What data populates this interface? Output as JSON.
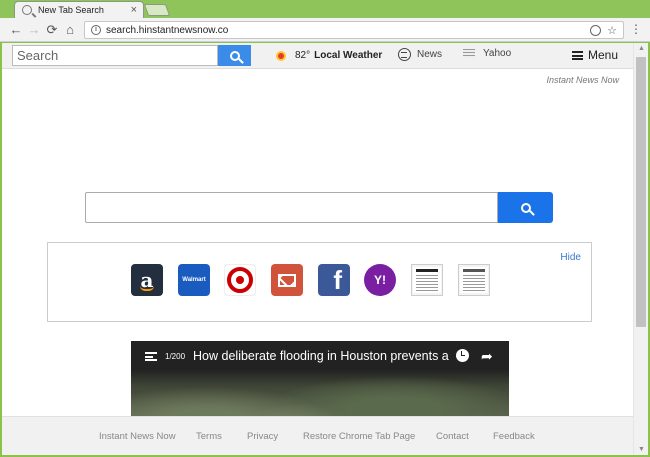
{
  "browser": {
    "tab_title": "New Tab Search",
    "tab_close": "×",
    "back": "←",
    "forward": "→",
    "reload": "⟳",
    "home": "⌂",
    "url": "search.hinstantnewsnow.co",
    "info": "i",
    "bookmark_star": "☆",
    "menu_dots": "⋮"
  },
  "topbar": {
    "search_placeholder": "Search",
    "temperature": "82°",
    "weather_label": "Local Weather",
    "news_label": "News",
    "yahoo_label": "Yahoo",
    "menu_label": "Menu"
  },
  "brand": "Instant News Now",
  "tiles": {
    "hide_label": "Hide",
    "items": [
      {
        "name": "Amazon",
        "glyph": "a"
      },
      {
        "name": "Walmart",
        "glyph": "Walmart"
      },
      {
        "name": "Target",
        "glyph": ""
      },
      {
        "name": "Gmail",
        "glyph": ""
      },
      {
        "name": "Facebook",
        "glyph": "f"
      },
      {
        "name": "Yahoo",
        "glyph": "Y!"
      }
    ]
  },
  "video": {
    "counter": "1/200",
    "title": "How deliberate flooding in Houston prevents a ..."
  },
  "footer": {
    "links": [
      "Instant News Now",
      "Terms",
      "Privacy",
      "Restore Chrome Tab Page",
      "Contact",
      "Feedback"
    ]
  },
  "colors": {
    "accent": "#1a73e8",
    "frame": "#8bc34a"
  }
}
